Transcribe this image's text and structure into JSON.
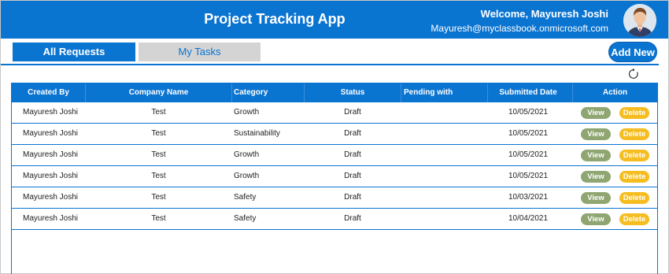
{
  "header": {
    "title": "Project Tracking App",
    "welcome": "Welcome, Mayuresh Joshi",
    "email": "Mayuresh@myclassbook.onmicrosoft.com",
    "color": "#0a74d1"
  },
  "tabs": [
    {
      "label": "All Requests",
      "active": true
    },
    {
      "label": "My Tasks",
      "active": false
    }
  ],
  "actions": {
    "add_new": "Add New",
    "refresh_icon": "refresh-icon"
  },
  "table": {
    "columns": [
      "Created By",
      "Company Name",
      "Category",
      "Status",
      "Pending with",
      "Submitted Date",
      "Action"
    ],
    "rows": [
      {
        "created_by": "Mayuresh Joshi",
        "company": "Test",
        "category": "Growth",
        "status": "Draft",
        "pending_with": "",
        "submitted": "10/05/2021"
      },
      {
        "created_by": "Mayuresh Joshi",
        "company": "Test",
        "category": "Sustainability",
        "status": "Draft",
        "pending_with": "",
        "submitted": "10/05/2021"
      },
      {
        "created_by": "Mayuresh Joshi",
        "company": "Test",
        "category": "Growth",
        "status": "Draft",
        "pending_with": "",
        "submitted": "10/05/2021"
      },
      {
        "created_by": "Mayuresh Joshi",
        "company": "Test",
        "category": "Growth",
        "status": "Draft",
        "pending_with": "",
        "submitted": "10/05/2021"
      },
      {
        "created_by": "Mayuresh Joshi",
        "company": "Test",
        "category": "Safety",
        "status": "Draft",
        "pending_with": "",
        "submitted": "10/03/2021"
      },
      {
        "created_by": "Mayuresh Joshi",
        "company": "Test",
        "category": "Safety",
        "status": "Draft",
        "pending_with": "",
        "submitted": "10/04/2021"
      }
    ],
    "view_label": "View",
    "delete_label": "Delete",
    "view_color": "#8fa672",
    "delete_color": "#f5bd1f"
  }
}
